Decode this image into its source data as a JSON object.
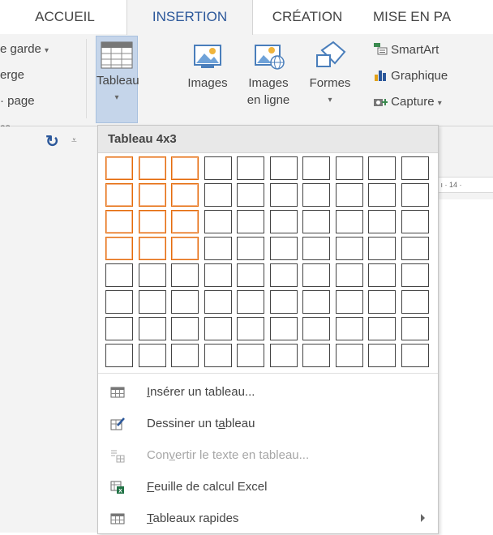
{
  "tabs": [
    {
      "label": "ACCUEIL"
    },
    {
      "label": "INSERTION"
    },
    {
      "label": "CRÉATION"
    },
    {
      "label": "MISE EN PA"
    }
  ],
  "ribbon": {
    "pages_group": {
      "items": [
        "e garde",
        "erge",
        "· page"
      ],
      "label": "es"
    },
    "table_button": {
      "label": "Tableau"
    },
    "images_button": {
      "label": "Images"
    },
    "online_images_button": {
      "label_line1": "Images",
      "label_line2": "en ligne"
    },
    "shapes_button": {
      "label": "Formes"
    },
    "smartart_button": {
      "label": "SmartArt"
    },
    "chart_button": {
      "label": "Graphique"
    },
    "capture_button": {
      "label": "Capture"
    }
  },
  "ruler": {
    "text": "· ı · 14 ·"
  },
  "dropdown": {
    "header": "Tableau 4x3",
    "grid": {
      "columns": 10,
      "rows": 8,
      "selected_columns": 3,
      "selected_rows": 4
    },
    "menu": [
      {
        "pre": "",
        "key": "I",
        "post": "nsérer un tableau...",
        "icon": "table-grid-icon",
        "disabled": false
      },
      {
        "pre": "Dessiner un t",
        "key": "a",
        "post": "bleau",
        "icon": "draw-table-icon",
        "disabled": false
      },
      {
        "pre": "Con",
        "key": "v",
        "post": "ertir le texte en tableau...",
        "icon": "convert-text-icon",
        "disabled": true
      },
      {
        "pre": "",
        "key": "F",
        "post": "euille de calcul Excel",
        "icon": "excel-sheet-icon",
        "disabled": false
      },
      {
        "pre": "",
        "key": "T",
        "post": "ableaux rapides",
        "icon": "quick-tables-icon",
        "disabled": false
      }
    ]
  },
  "colors": {
    "accent": "#2b579a",
    "selection": "#e46c0a",
    "ribbon_bg": "#f3f3f3"
  }
}
